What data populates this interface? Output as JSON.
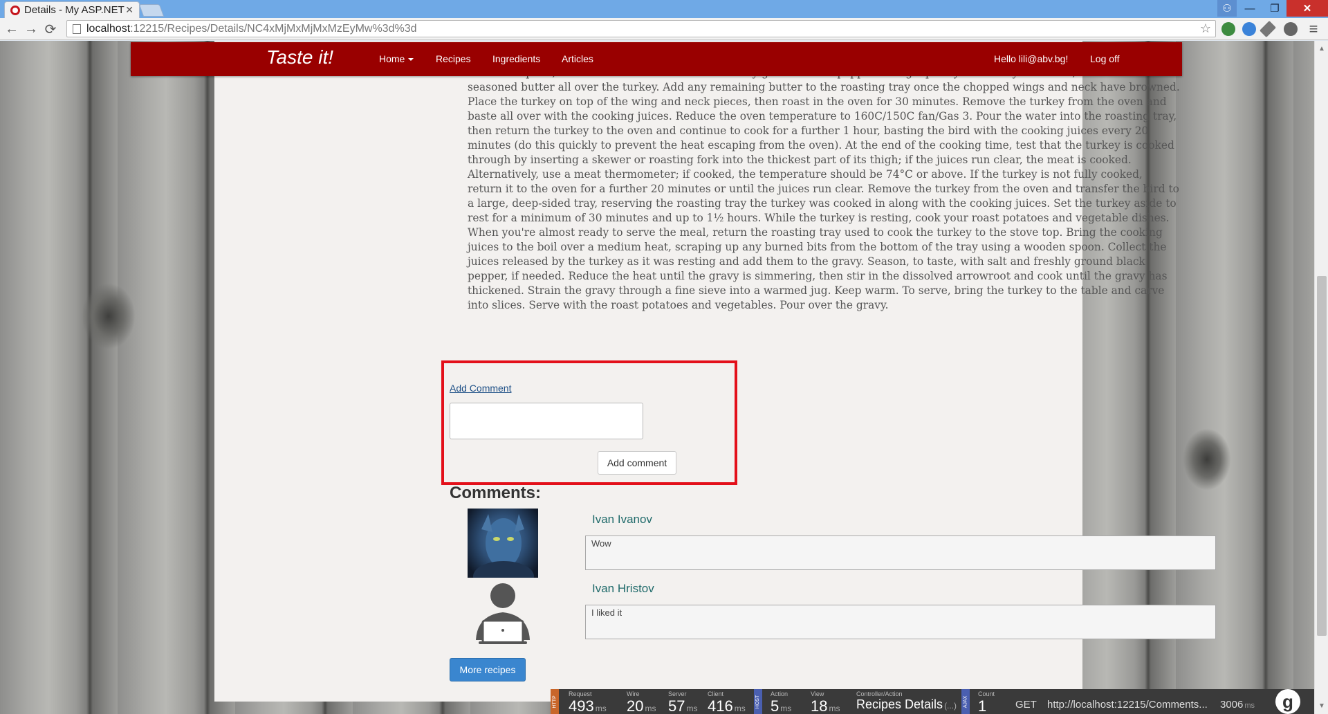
{
  "browser": {
    "tab_title": "Details - My ASP.NET",
    "tab_close": "✕",
    "url_host": "localhost",
    "url_path": ":12215/Recipes/Details/NC4xMjMxMjMxMzEyMw%3d%3d",
    "star": "☆",
    "back": "←",
    "forward": "→",
    "reload": "⟳",
    "menu": "≡",
    "minimize": "—",
    "maximize": "❐",
    "close": "✕",
    "user": "⚇"
  },
  "navbar": {
    "brand": "Taste it!",
    "links": [
      "Home",
      "Recipes",
      "Ingredients",
      "Articles"
    ],
    "greeting": "Hello lili@abv.bg!",
    "logoff": "Log off"
  },
  "recipe": {
    "text": "a dessert spoon, then season with the salt and freshly ground white pepper. Using a pastry brush or your hands, smear the seasoned butter all over the turkey. Add any remaining butter to the roasting tray once the chopped wings and neck have browned. Place the turkey on top of the wing and neck pieces, then roast in the oven for 30 minutes. Remove the turkey from the oven and baste all over with the cooking juices. Reduce the oven temperature to 160C/150C fan/Gas 3. Pour the water into the roasting tray, then return the turkey to the oven and continue to cook for a further 1 hour, basting the bird with the cooking juices every 20 minutes (do this quickly to prevent the heat escaping from the oven). At the end of the cooking time, test that the turkey is cooked through by inserting a skewer or roasting fork into the thickest part of its thigh; if the juices run clear, the meat is cooked. Alternatively, use a meat thermometer; if cooked, the temperature should be 74°C or above. If the turkey is not fully cooked, return it to the oven for a further 20 minutes or until the juices run clear. Remove the turkey from the oven and transfer the bird to a large, deep-sided tray, reserving the roasting tray the turkey was cooked in along with the cooking juices. Set the turkey aside to rest for a minimum of 30 minutes and up to 1½ hours. While the turkey is resting, cook your roast potatoes and vegetable dishes. When you're almost ready to serve the meal, return the roasting tray used to cook the turkey to the stove top. Bring the cooking juices to the boil over a medium heat, scraping up any burned bits from the bottom of the tray using a wooden spoon. Collect the juices released by the turkey as it was resting and add them to the gravy. Season, to taste, with salt and freshly ground black pepper, if needed. Reduce the heat until the gravy is simmering, then stir in the dissolved arrowroot and cook until the gravy has thickened. Strain the gravy through a fine sieve into a warmed jug. Keep warm. To serve, bring the turkey to the table and carve into slices. Serve with the roast potatoes and vegetables. Pour over the gravy."
  },
  "comment_form": {
    "toggle_link": "Add Comment",
    "input_value": "",
    "submit_label": "Add comment"
  },
  "comments": {
    "heading": "Comments:",
    "items": [
      {
        "author": "Ivan Ivanov",
        "text": "Wow"
      },
      {
        "author": "Ivan Hristov",
        "text": "I liked it"
      }
    ]
  },
  "more_recipes": "More recipes",
  "glimpse": {
    "http_tag": "HTTP",
    "host_tag": "HOST",
    "ajax_tag": "AJAX",
    "request": {
      "label": "Request",
      "value": "493",
      "unit": "ms"
    },
    "wire": {
      "label": "Wire",
      "value": "20",
      "unit": "ms"
    },
    "server": {
      "label": "Server",
      "value": "57",
      "unit": "ms"
    },
    "client": {
      "label": "Client",
      "value": "416",
      "unit": "ms"
    },
    "action": {
      "label": "Action",
      "value": "5",
      "unit": "ms"
    },
    "view": {
      "label": "View",
      "value": "18",
      "unit": "ms"
    },
    "controller_action": {
      "label": "Controller/Action",
      "value": "Recipes Details",
      "suffix": "(...)"
    },
    "count": {
      "label": "Count",
      "value": "1"
    },
    "method": "GET",
    "ajax_url": "http://localhost:12215/Comments...",
    "ajax_time": "3006",
    "ajax_unit": "ms"
  }
}
